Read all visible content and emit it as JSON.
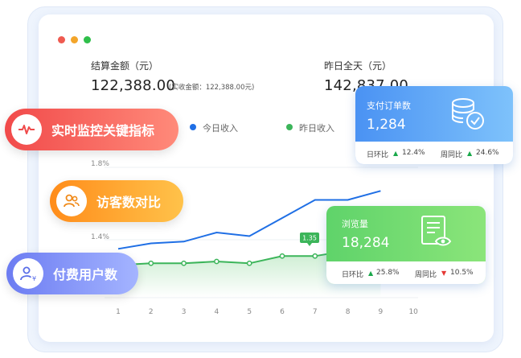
{
  "window": {
    "dots": [
      "#ef5a50",
      "#f3a52a",
      "#2fbf4a"
    ]
  },
  "summary": {
    "settled_label": "结算金额（元）",
    "settled_value": "122,388.00",
    "actual_note": "(实收金额：122,388.00元)",
    "yesterday_label": "昨日全天（元）",
    "yesterday_value": "142,837.00"
  },
  "legend": {
    "today": "今日收入",
    "yesterday": "昨日收入",
    "today_color": "#1f6fe5",
    "yesterday_color": "#3cb55a"
  },
  "pills": {
    "realtime": "实时监控关键指标",
    "visitors": "访客数对比",
    "paid_users": "付费用户数"
  },
  "cards": {
    "orders": {
      "title": "支付订单数",
      "value": "1,284",
      "dod_label": "日环比",
      "dod_value": "12.4%",
      "wow_label": "周同比",
      "wow_value": "24.6%",
      "icon": "coins-check-icon"
    },
    "views": {
      "title": "浏览量",
      "value": "18,284",
      "dod_label": "日环比",
      "dod_value": "25.8%",
      "wow_label": "周同比",
      "wow_value": "10.5%",
      "icon": "document-view-icon"
    }
  },
  "chart_data": {
    "type": "line",
    "x": [
      1,
      2,
      3,
      4,
      5,
      6,
      7,
      8,
      9,
      10
    ],
    "y_ticks": [
      "1.8%",
      "1.4%"
    ],
    "series": [
      {
        "name": "今日收入",
        "values": [
          1.35,
          1.38,
          1.39,
          1.44,
          1.42,
          1.52,
          1.62,
          1.62,
          1.67
        ]
      },
      {
        "name": "昨日收入",
        "values": [
          1.26,
          1.27,
          1.27,
          1.28,
          1.27,
          1.31,
          1.31,
          1.34,
          1.36
        ]
      }
    ],
    "tooltip": "1.35"
  }
}
